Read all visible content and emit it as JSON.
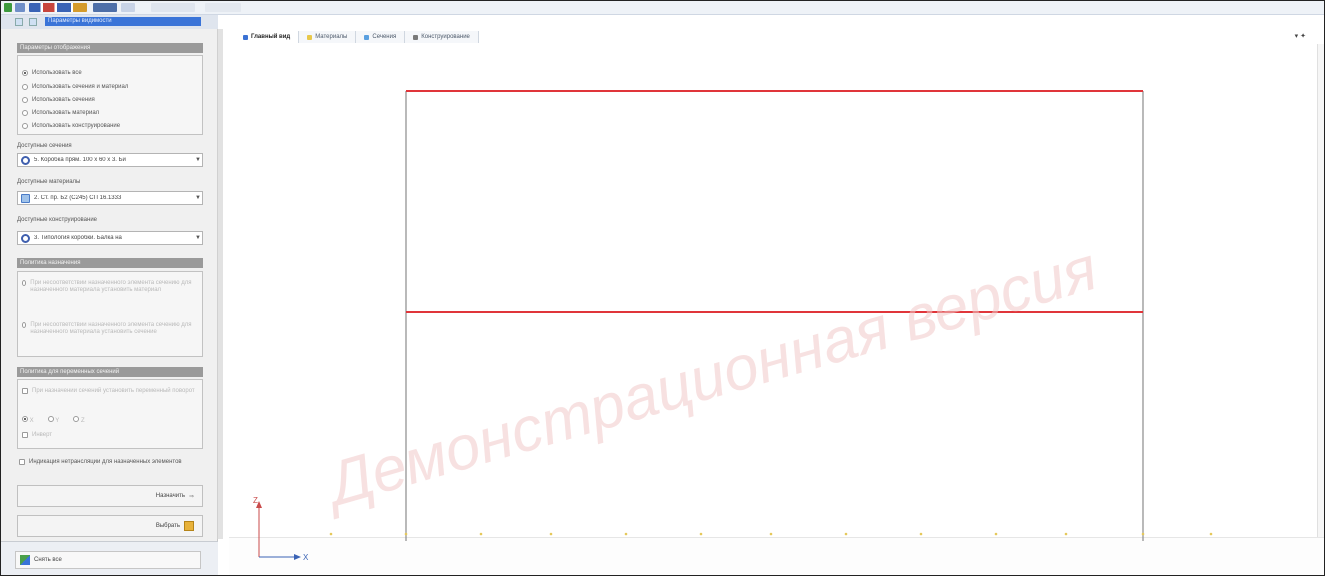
{
  "left_panel": {
    "title_selection": "Параметры видимости",
    "section_visibility": "Параметры отображения",
    "radio_options": [
      {
        "label": "Использовать все",
        "selected": true
      },
      {
        "label": "Использовать сечения и материал",
        "selected": false
      },
      {
        "label": "Использовать сечения",
        "selected": false
      },
      {
        "label": "Использовать материал",
        "selected": false
      },
      {
        "label": "Использовать конструирование",
        "selected": false
      }
    ],
    "available_sections_label": "Доступные сечения",
    "available_sections_value": "5. Коробка прям. 100 x 60 x 3. Би",
    "available_materials_label": "Доступные материалы",
    "available_materials_value": "2. Ст. пр. Б2 (С245) СП 16.1333",
    "available_design_label": "Доступные конструирование",
    "available_design_value": "3. Типология коробки. Балка на",
    "section_placement": "Политика назначения",
    "placement_options": [
      "При несоответствии назначенного элемента сечению для назначенного материала установить материал",
      "При несоответствии назначенного элемента сечению для назначенного материала установить сечение"
    ],
    "section_rotation": "Политика для переменных сечений",
    "rotation_options": [
      "При назначении сечений установить переменный поворот"
    ],
    "axis_options": [
      "X",
      "Y",
      "Z"
    ],
    "invert_label": "Инверт",
    "indicator_label": "Индикация нетрансляции для назначенных элементов",
    "assign_button": "Назначить",
    "select_button": "Выбрать",
    "show_all_button": "Снять все"
  },
  "tabs": [
    {
      "label": "Главный вид",
      "active": true,
      "color": "#3b72d4"
    },
    {
      "label": "Материалы",
      "active": false,
      "color": "#e8c84a"
    },
    {
      "label": "Сечения",
      "active": false,
      "color": "#5aa0e0"
    },
    {
      "label": "Конструирование",
      "active": false,
      "color": "#7a7a7a"
    }
  ],
  "viewport": {
    "watermark": "Демонстрационная версия",
    "axis_x": "X",
    "axis_z": "Z",
    "line_color": "#e0353a",
    "frame_color": "#888888"
  }
}
